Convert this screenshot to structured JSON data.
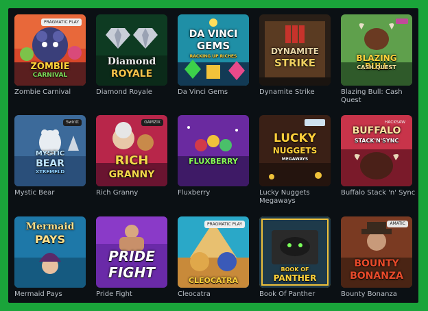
{
  "games": [
    {
      "title": "Zombie Carnival",
      "art": [
        "ZOMBIE",
        "CARNIVAL"
      ],
      "provider": "PRAGMATIC PLAY"
    },
    {
      "title": "Diamond Royale",
      "art": [
        "Diamond",
        "ROYALE"
      ],
      "provider": ""
    },
    {
      "title": "Da Vinci Gems",
      "art": [
        "DA VINCI",
        "GEMS",
        "RACKING UP RICHES"
      ],
      "provider": ""
    },
    {
      "title": "Dynamite Strike",
      "art": [
        "DYNAMITE",
        "STRIKE"
      ],
      "provider": ""
    },
    {
      "title": "Blazing Bull: Cash Quest",
      "art": [
        "BLAZING BULL",
        "CASH QUEST"
      ],
      "provider": ""
    },
    {
      "title": "Mystic Bear",
      "art": [
        "MYSTIC",
        "BEAR",
        "XTREMELD"
      ],
      "provider": "Swintt"
    },
    {
      "title": "Rich Granny",
      "art": [
        "RICH",
        "GRANNY"
      ],
      "provider": "GAMZIX"
    },
    {
      "title": "Fluxberry",
      "art": [
        "FLUXBERRY"
      ],
      "provider": ""
    },
    {
      "title": "Lucky Nuggets Megaways",
      "art": [
        "LUCKY",
        "NUGGETS",
        "MEGAWAYS"
      ],
      "provider": ""
    },
    {
      "title": "Buffalo Stack 'n' Sync",
      "art": [
        "BUFFALO",
        "STACK'N'SYNC"
      ],
      "provider": "HACKSAW"
    },
    {
      "title": "Mermaid Pays",
      "art": [
        "Mermaid",
        "PAYS"
      ],
      "provider": ""
    },
    {
      "title": "Pride Fight",
      "art": [
        "PRIDE",
        "FIGHT"
      ],
      "provider": ""
    },
    {
      "title": "Cleocatra",
      "art": [
        "CLEOCATRA"
      ],
      "provider": "PRAGMATIC PLAY"
    },
    {
      "title": "Book Of Panther",
      "art": [
        "BOOK OF",
        "PANTHER"
      ],
      "provider": ""
    },
    {
      "title": "Bounty Bonanza",
      "art": [
        "BOUNTY",
        "BONANZA"
      ],
      "provider": "AMATIC"
    }
  ]
}
